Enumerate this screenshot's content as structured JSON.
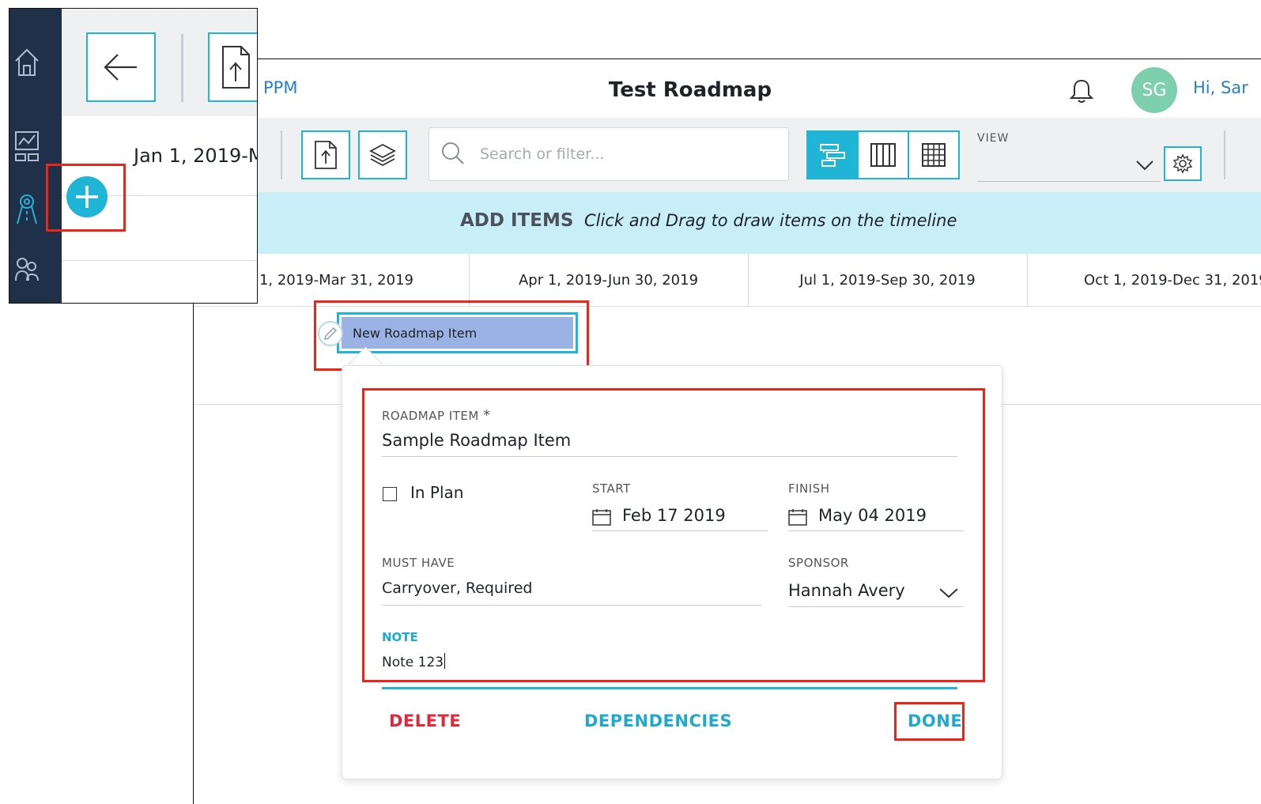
{
  "header": {
    "app_name": "PPM",
    "page_title": "Test Roadmap",
    "avatar_initials": "SG",
    "greeting": "Hi, Sar"
  },
  "toolbar": {
    "search_placeholder": "Search or filter...",
    "view_label": "VIEW",
    "view_value": ""
  },
  "banner": {
    "title": "ADD ITEMS",
    "hint": "Click and Drag to draw items on the timeline"
  },
  "timeline": {
    "periods": [
      "an 1, 2019-Mar 31, 2019",
      "Apr 1, 2019-Jun 30, 2019",
      "Jul 1, 2019-Sep 30, 2019",
      "Oct 1, 2019-Dec 31, 2019"
    ]
  },
  "roadmap_bar": {
    "label": "New Roadmap Item"
  },
  "popup": {
    "item_label": "ROADMAP ITEM",
    "required_mark": "*",
    "item_value": "Sample Roadmap Item",
    "in_plan_label": "In Plan",
    "in_plan_checked": false,
    "start_label": "START",
    "start_value": "Feb 17 2019",
    "finish_label": "FINISH",
    "finish_value": "May 04 2019",
    "must_have_label": "MUST HAVE",
    "must_have_value": "Carryover, Required",
    "sponsor_label": "SPONSOR",
    "sponsor_value": "Hannah Avery",
    "note_label": "NOTE",
    "note_value": "Note 123",
    "delete_label": "DELETE",
    "dependencies_label": "DEPENDENCIES",
    "done_label": "DONE"
  },
  "inset": {
    "date_label": "Jan 1, 2019-M"
  },
  "colors": {
    "accent": "#20b5d6",
    "highlight": "#e8261a",
    "delete": "#e0283c",
    "rail": "#1f3048",
    "bar": "#9bb3e4",
    "banner": "#c8eef7"
  }
}
